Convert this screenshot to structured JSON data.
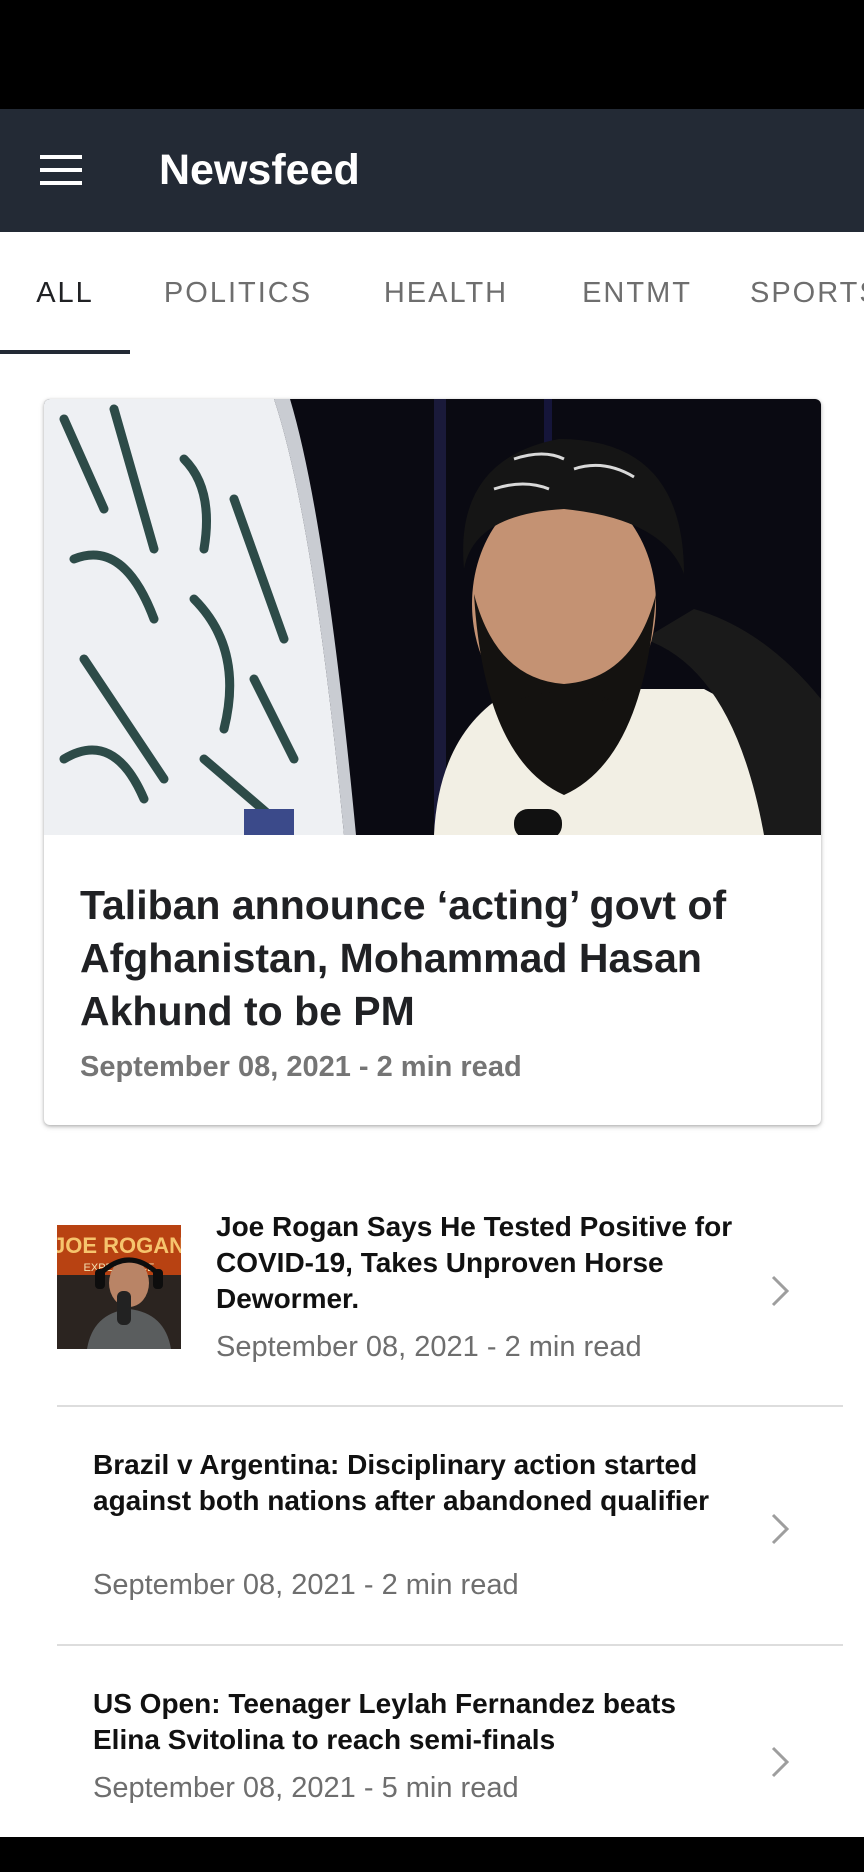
{
  "app_bar": {
    "title": "Newsfeed",
    "menu_icon": "hamburger-menu-icon",
    "background": "#232a35"
  },
  "tabs": [
    {
      "label": "ALL",
      "active": true
    },
    {
      "label": "POLITICS",
      "active": false
    },
    {
      "label": "HEALTH",
      "active": false
    },
    {
      "label": "ENTMT",
      "active": false
    },
    {
      "label": "SPORTS",
      "active": false
    }
  ],
  "featured": {
    "title": "Taliban announce ‘acting’ govt of Afghanistan, Mohammad Hasan Akhund to be PM",
    "meta": "September 08, 2021 - 2 min read"
  },
  "articles": [
    {
      "title": "Joe Rogan Says He Tested Positive for COVID-19, Takes Unproven Horse Dewormer.",
      "meta": "September 08, 2021 - 2 min read",
      "has_thumbnail": true,
      "thumbnail_lettering": "JOE ROGAN EXPERIENCE"
    },
    {
      "title": "Brazil v Argentina: Disciplinary action started against both nations after abandoned qualifier",
      "meta": "September 08, 2021 - 2 min read",
      "has_thumbnail": false
    },
    {
      "title": "US Open: Teenager Leylah Fernandez beats Elina Svitolina to reach semi-finals",
      "meta": "September 08, 2021 - 5 min read",
      "has_thumbnail": false
    }
  ],
  "icons": {
    "menu": "hamburger-menu-icon",
    "chevron": "chevron-right-icon"
  },
  "colors": {
    "status_bar": "#000000",
    "app_bar": "#232a35",
    "text_primary": "#202124",
    "text_secondary": "#757575",
    "tab_inactive": "#6e6e6e",
    "divider": "#dddddd"
  }
}
